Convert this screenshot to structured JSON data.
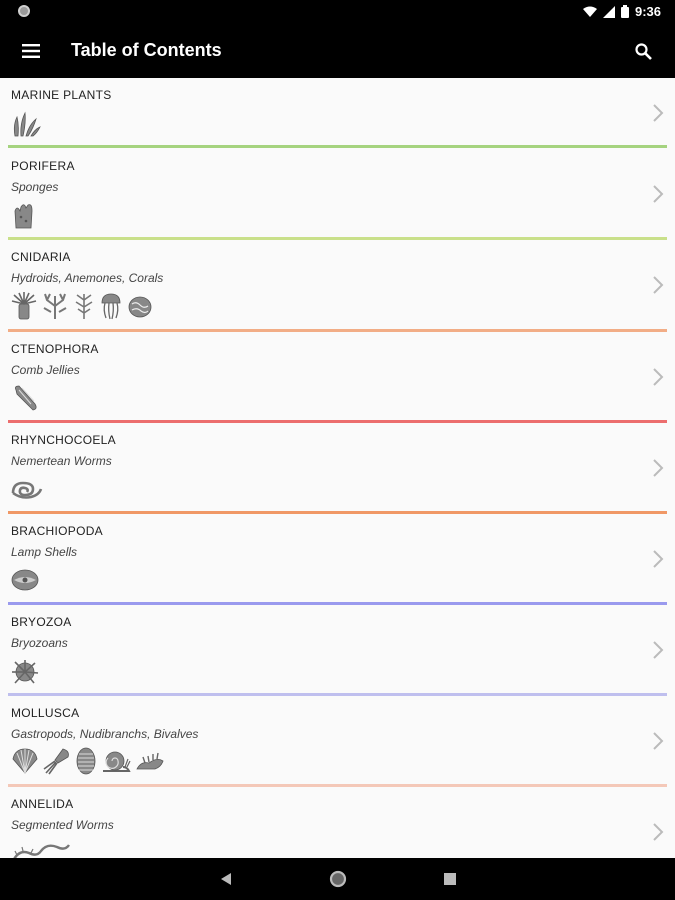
{
  "status": {
    "time": "9:36"
  },
  "app_bar": {
    "title": "Table of Contents"
  },
  "colors": {
    "marine": "#a5d37f",
    "porifera": "#c9e08a",
    "cnidaria": "#f2ad86",
    "ctenophora": "#ec6e6e",
    "rhynchocoela": "#f09866",
    "brachiopoda": "#9a9aee",
    "bryozoa": "#bfbfee",
    "mollusca": "#f4c8b8"
  },
  "sections": [
    {
      "title": "MARINE PLANTS",
      "subtitle": "",
      "icons": [
        "seaweed-icon"
      ]
    },
    {
      "title": "PORIFERA",
      "subtitle": "Sponges",
      "icons": [
        "sponge-icon"
      ]
    },
    {
      "title": "CNIDARIA",
      "subtitle": "Hydroids, Anemones, Corals",
      "icons": [
        "anemone-icon",
        "coral-icon",
        "hydroid-icon",
        "jellyfish-icon",
        "brain-coral-icon"
      ]
    },
    {
      "title": "CTENOPHORA",
      "subtitle": "Comb Jellies",
      "icons": [
        "comb-jelly-icon"
      ]
    },
    {
      "title": "RHYNCHOCOELA",
      "subtitle": "Nemertean Worms",
      "icons": [
        "worm-icon"
      ]
    },
    {
      "title": "BRACHIOPODA",
      "subtitle": "Lamp Shells",
      "icons": [
        "lamp-shell-icon"
      ]
    },
    {
      "title": "BRYOZOA",
      "subtitle": "Bryozoans",
      "icons": [
        "bryozoan-icon"
      ]
    },
    {
      "title": "MOLLUSCA",
      "subtitle": "Gastropods, Nudibranchs, Bivalves",
      "icons": [
        "scallop-icon",
        "squid-icon",
        "chiton-icon",
        "snail-icon",
        "nudibranch-icon"
      ]
    },
    {
      "title": "ANNELIDA",
      "subtitle": "Segmented Worms",
      "icons": [
        "annelid-icon"
      ]
    }
  ]
}
